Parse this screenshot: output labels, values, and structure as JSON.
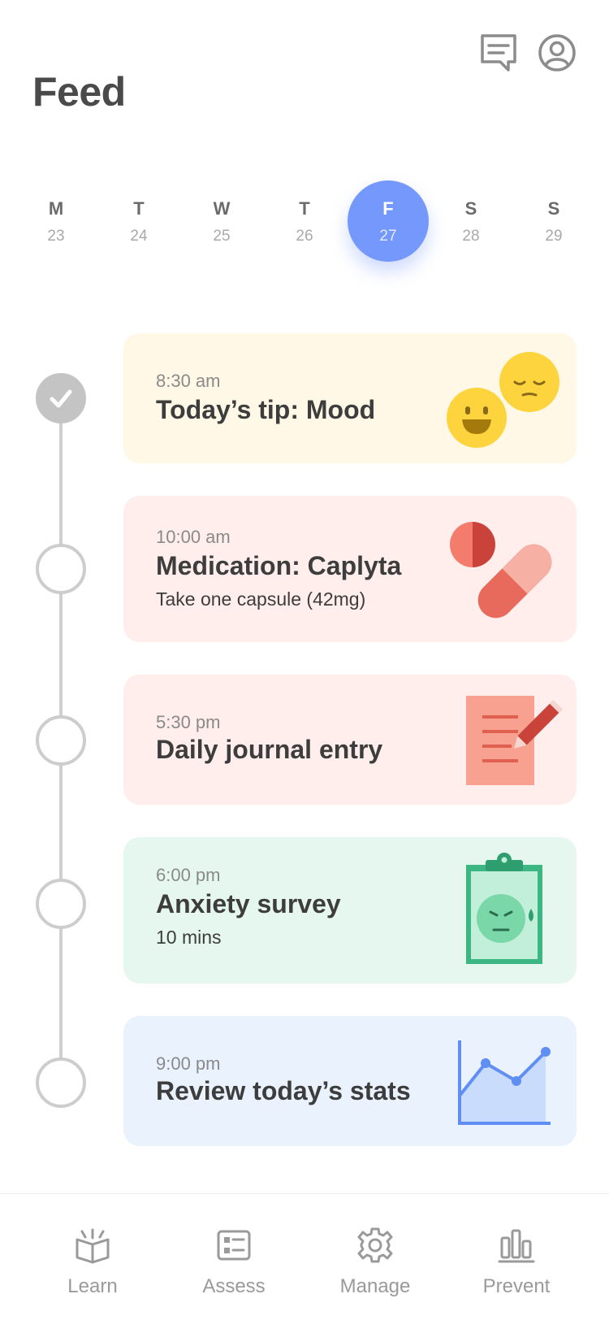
{
  "header": {
    "title": "Feed",
    "icons": [
      "chat-icon",
      "profile-icon"
    ]
  },
  "week": {
    "days": [
      {
        "letter": "M",
        "date": "23",
        "selected": false
      },
      {
        "letter": "T",
        "date": "24",
        "selected": false
      },
      {
        "letter": "W",
        "date": "25",
        "selected": false
      },
      {
        "letter": "T",
        "date": "26",
        "selected": false
      },
      {
        "letter": "F",
        "date": "27",
        "selected": true
      },
      {
        "letter": "S",
        "date": "28",
        "selected": false
      },
      {
        "letter": "S",
        "date": "29",
        "selected": false
      }
    ]
  },
  "feed": {
    "items": [
      {
        "time": "8:30 am",
        "title": "Today’s tip: Mood",
        "subtitle": "",
        "completed": true,
        "color": "#fff8e6",
        "icon": "mood-emoji-icon"
      },
      {
        "time": "10:00 am",
        "title": "Medication: Caplyta",
        "subtitle": "Take one capsule (42mg)",
        "completed": false,
        "color": "#ffeeeb",
        "icon": "pill-capsule-icon"
      },
      {
        "time": "5:30 pm",
        "title": "Daily journal entry",
        "subtitle": "",
        "completed": false,
        "color": "#ffeeeb",
        "icon": "journal-pencil-icon"
      },
      {
        "time": "6:00 pm",
        "title": "Anxiety survey",
        "subtitle": "10 mins",
        "completed": false,
        "color": "#e6f7ef",
        "icon": "clipboard-survey-icon"
      },
      {
        "time": "9:00 pm",
        "title": "Review today’s stats",
        "subtitle": "",
        "completed": false,
        "color": "#eaf2fe",
        "icon": "line-chart-icon"
      }
    ]
  },
  "nav": {
    "items": [
      {
        "label": "Learn",
        "icon": "book-icon"
      },
      {
        "label": "Assess",
        "icon": "checklist-icon"
      },
      {
        "label": "Manage",
        "icon": "gear-icon"
      },
      {
        "label": "Prevent",
        "icon": "bar-chart-icon"
      }
    ]
  },
  "colors": {
    "accent": "#7598fd",
    "timeline": "#cdcdcd",
    "nav_text": "#9a9a9a"
  }
}
